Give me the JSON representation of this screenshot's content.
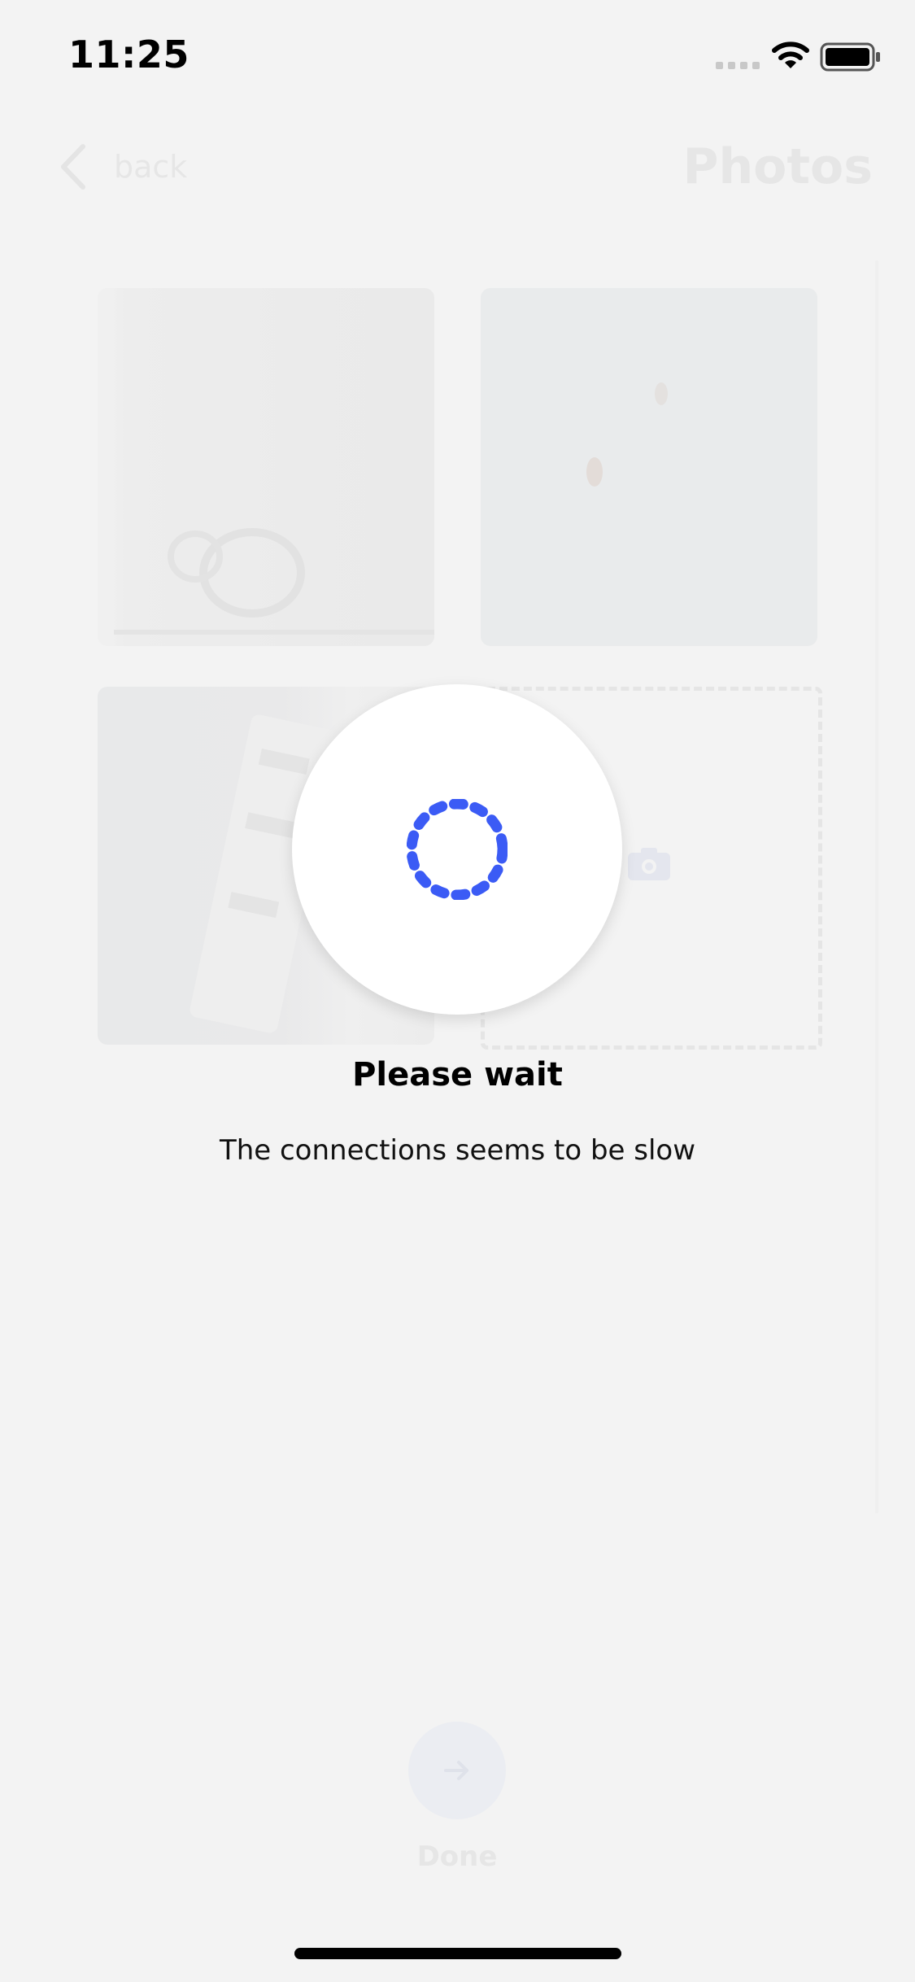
{
  "status_bar": {
    "time": "11:25",
    "signal_icon": "signal-icon",
    "wifi_icon": "wifi-icon",
    "battery_icon": "battery-icon"
  },
  "nav": {
    "back_label": "back",
    "title": "Photos",
    "back_icon": "chevron-left-icon"
  },
  "photos": {
    "tiles": [
      "photo",
      "photo",
      "photo"
    ],
    "add_icon": "camera-icon"
  },
  "loading": {
    "title": "Please wait",
    "message": "The connections seems to be slow",
    "spinner_color": "#3b5bf5"
  },
  "footer": {
    "done_label": "Done",
    "done_icon": "arrow-right-icon"
  },
  "colors": {
    "background": "#f3f3f3",
    "accent": "#3b5bf5",
    "faded_text": "#e6e6e6"
  }
}
